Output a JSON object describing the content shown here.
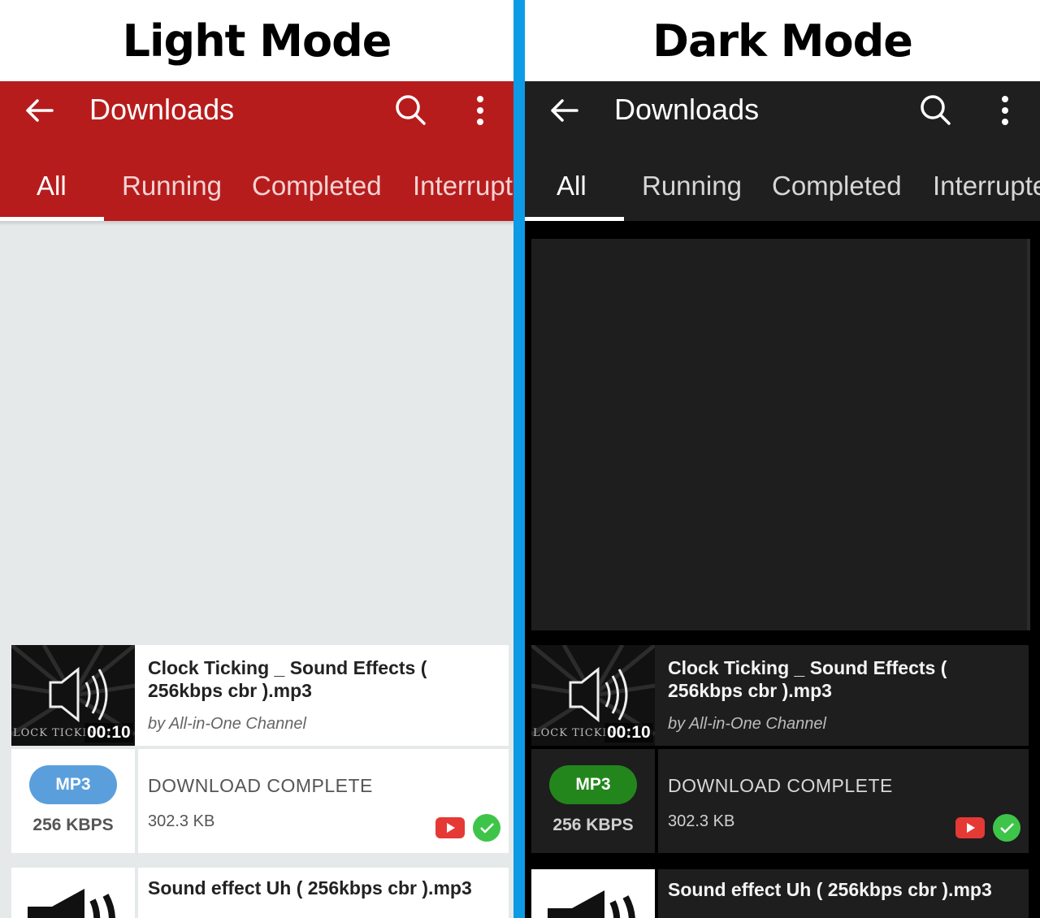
{
  "headings": {
    "light": "Light Mode",
    "dark": "Dark Mode"
  },
  "colors": {
    "divider": "#0d9be6",
    "light_appbar": "#b71c1c",
    "dark_appbar": "#1f1f1f",
    "mp3_light": "#5a9fdc",
    "mp3_dark": "#23861d",
    "check": "#3fc44a",
    "youtube": "#e53935"
  },
  "appbar": {
    "title": "Downloads",
    "back_icon": "arrow-left-icon",
    "search_icon": "search-icon",
    "menu_icon": "more-vert-icon"
  },
  "tabs": [
    {
      "label": "All",
      "active": true
    },
    {
      "label": "Running",
      "active": false
    },
    {
      "label": "Completed",
      "active": false
    },
    {
      "label": "Interrupted",
      "active": false
    }
  ],
  "tabs_display_light": [
    "All",
    "Running",
    "Completed",
    "Interrupte"
  ],
  "tabs_display_dark": [
    "All",
    "Running",
    "Completed",
    "Interrupte"
  ],
  "downloads": [
    {
      "title": "Clock Ticking _ Sound Effects ( 256kbps cbr ).mp3",
      "author": "by All-in-One Channel",
      "thumb_label": "LOCK TICKING/",
      "duration": "00:10",
      "format": "MP3",
      "bitrate": "256 KBPS",
      "status": "DOWNLOAD COMPLETE",
      "size": "302.3 KB"
    },
    {
      "title": "Sound effect Uh ( 256kbps cbr ).mp3"
    }
  ]
}
